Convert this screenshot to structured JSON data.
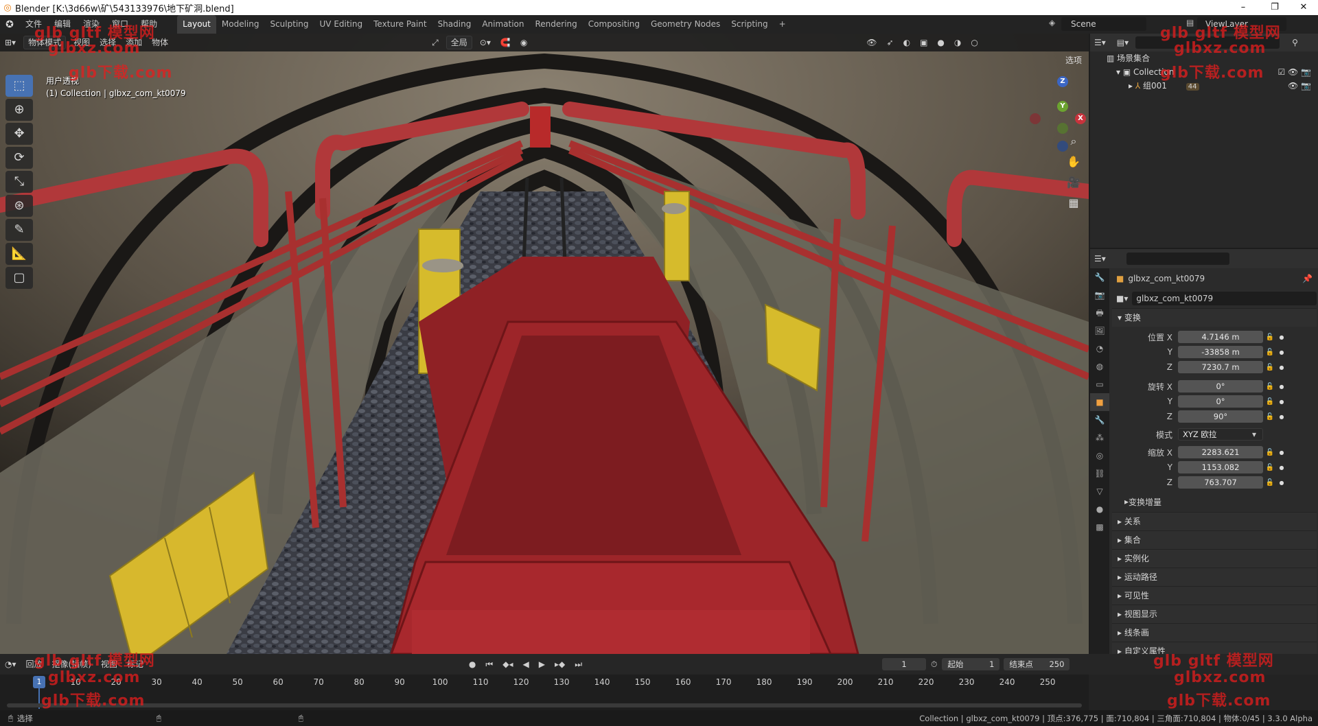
{
  "window": {
    "title": "Blender [K:\\3d66w\\矿\\543133976\\地下矿洞.blend]",
    "controls": [
      "–",
      "❐",
      "✕"
    ]
  },
  "menus": [
    "文件",
    "编辑",
    "渲染",
    "窗口",
    "帮助"
  ],
  "workspaces": [
    {
      "label": "Layout",
      "active": true
    },
    {
      "label": "Modeling"
    },
    {
      "label": "Sculpting"
    },
    {
      "label": "UV Editing"
    },
    {
      "label": "Texture Paint"
    },
    {
      "label": "Shading"
    },
    {
      "label": "Animation"
    },
    {
      "label": "Rendering"
    },
    {
      "label": "Compositing"
    },
    {
      "label": "Geometry Nodes"
    },
    {
      "label": "Scripting"
    },
    {
      "label": "+"
    }
  ],
  "scene": {
    "label": "Scene",
    "view_layer": "ViewLayer"
  },
  "viewport": {
    "mode": "物体模式",
    "menus": [
      "视图",
      "选择",
      "添加",
      "物体"
    ],
    "transform_orientation": "全局",
    "options": "选项",
    "overlay_title": "用户透视",
    "overlay_subtitle": "(1) Collection | glbxz_com_kt0079",
    "gizmo_axes": {
      "z": "Z",
      "y": "Y",
      "x": "X"
    }
  },
  "outliner": {
    "root": "场景集合",
    "collection": "Collection",
    "child": "组001",
    "child_badge": "44"
  },
  "properties": {
    "object_name": "glbxz_com_kt0079",
    "data_name": "glbxz_com_kt0079",
    "transform_title": "变换",
    "location": {
      "label": "位置 X",
      "x": "4.7146 m",
      "y": "-33858 m",
      "z": "7230.7 m"
    },
    "rotation": {
      "label": "旋转 X",
      "x": "0°",
      "y": "0°",
      "z": "90°"
    },
    "mode_label": "模式",
    "mode_value": "XYZ 欧拉",
    "scale": {
      "label": "缩放 X",
      "x": "2283.621",
      "y": "1153.082",
      "z": "763.707"
    },
    "axis_y": "Y",
    "axis_z": "Z",
    "delta": "变换增量",
    "panels": [
      "关系",
      "集合",
      "实例化",
      "运动路径",
      "可见性",
      "视图显示",
      "线条画",
      "自定义属性"
    ]
  },
  "timeline": {
    "menus": [
      "回放",
      "抠像(插帧)",
      "视图",
      "标记"
    ],
    "current_frame": "1",
    "start_label": "起始",
    "start_value": "1",
    "end_label": "结束点",
    "end_value": "250",
    "ruler_current": "1",
    "ticks": [
      "10",
      "20",
      "30",
      "40",
      "50",
      "60",
      "70",
      "80",
      "90",
      "100",
      "110",
      "120",
      "130",
      "140",
      "150",
      "160",
      "170",
      "180",
      "190",
      "200",
      "210",
      "220",
      "230",
      "240",
      "250"
    ]
  },
  "statusbar": {
    "left": "选择",
    "right": "Collection | glbxz_com_kt0079 | 顶点:376,775 | 面:710,804 | 三角面:710,804 | 物体:0/45 | 3.3.0 Alpha"
  },
  "watermarks": [
    "glb gltf 模型网",
    "glbxz.com",
    "glb下载.com"
  ]
}
